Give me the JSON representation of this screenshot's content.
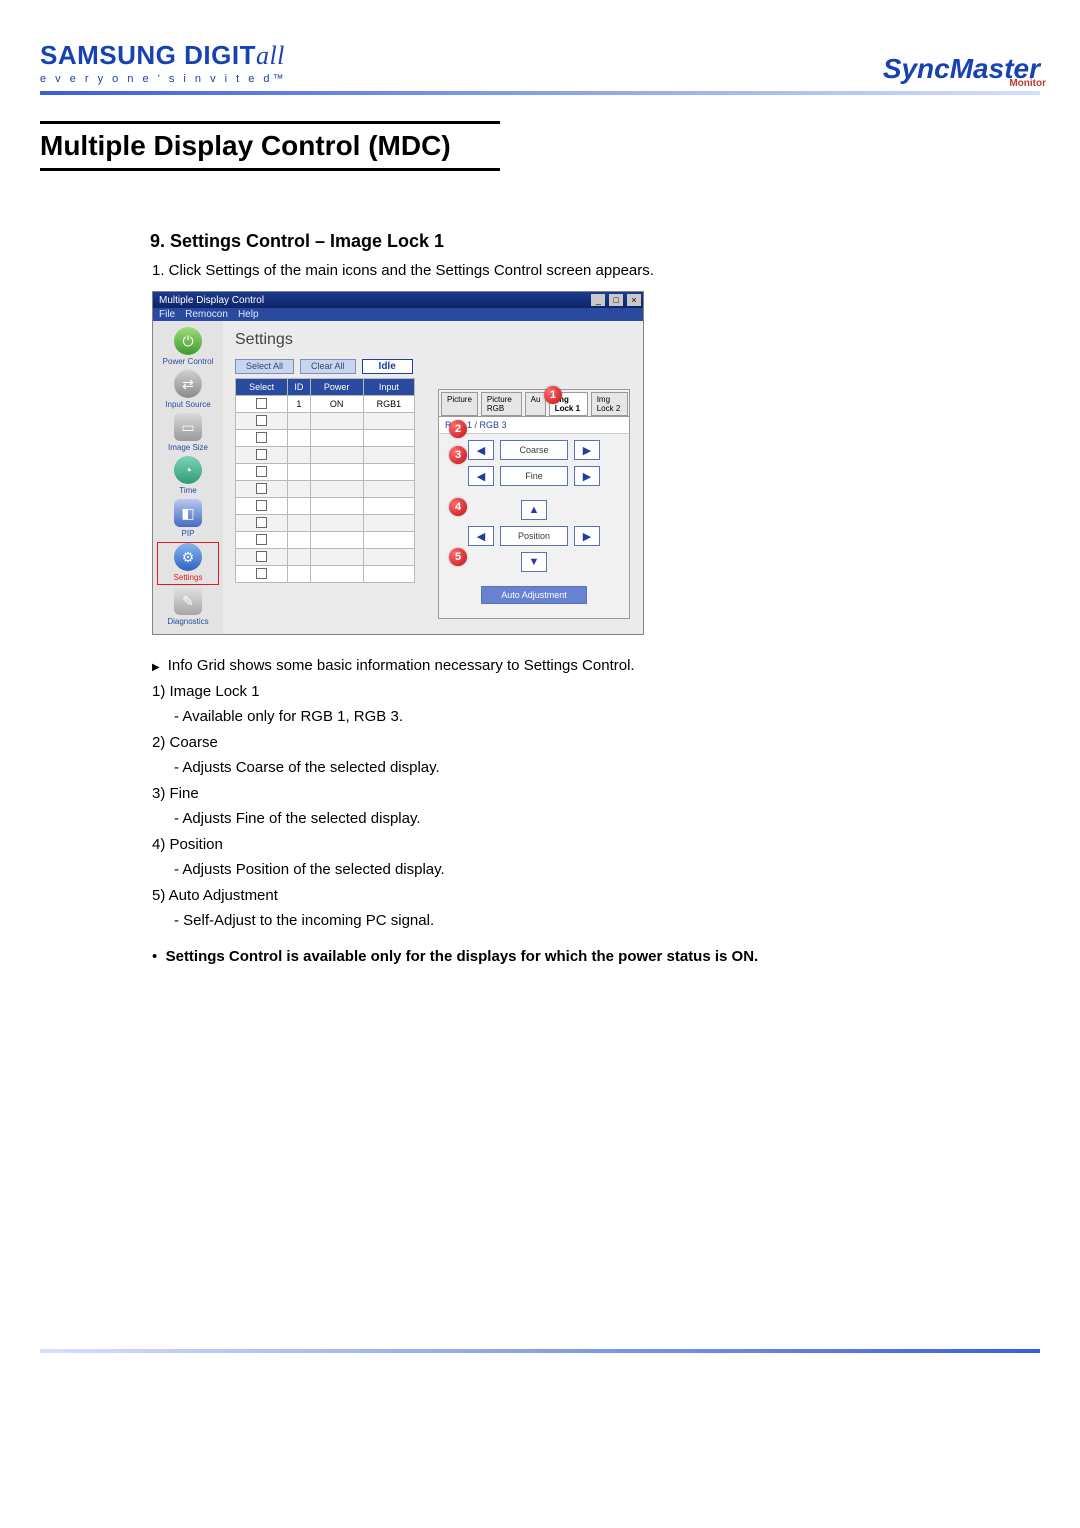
{
  "header": {
    "brand_main": "SAMSUNG DIGIT",
    "brand_italic": "all",
    "tagline": "e v e r y o n e ' s   i n v i t e d™",
    "right_brand": "SyncMaster",
    "right_sub": "Monitor"
  },
  "title": "Multiple Display Control (MDC)",
  "section": {
    "heading": "9. Settings Control – Image Lock 1",
    "step1": "1.  Click Settings of the main icons and the Settings Control screen appears."
  },
  "app": {
    "window_title": "Multiple Display Control",
    "menus": [
      "File",
      "Remocon",
      "Help"
    ],
    "sidebar": [
      {
        "label": "Power Control"
      },
      {
        "label": "Input Source"
      },
      {
        "label": "Image Size"
      },
      {
        "label": "Time"
      },
      {
        "label": "PIP"
      },
      {
        "label": "Settings"
      },
      {
        "label": "Diagnostics"
      }
    ],
    "settings_title": "Settings",
    "buttons": {
      "select_all": "Select All",
      "clear_all": "Clear All",
      "idle": "Idle"
    },
    "grid": {
      "headers": [
        "Select",
        "ID",
        "Power",
        "Input"
      ],
      "row": {
        "id": "1",
        "power": "ON",
        "input": "RGB1"
      }
    },
    "tabs": {
      "picture": "Picture",
      "picture_rgb": "Picture RGB",
      "audio_prefix": "Au",
      "img_lock1": "Img Lock 1",
      "img_lock2": "Img Lock 2"
    },
    "subtab": "RGB 1 / RGB 3",
    "controls": {
      "coarse": "Coarse",
      "fine": "Fine",
      "position": "Position",
      "auto": "Auto Adjustment"
    },
    "callouts": {
      "c1": "1",
      "c2": "2",
      "c3": "3",
      "c4": "4",
      "c5": "5"
    }
  },
  "notes": {
    "intro": "Info Grid shows some basic information necessary to Settings Control.",
    "n1a": "1) Image Lock 1",
    "n1b": "- Available only for RGB 1, RGB 3.",
    "n2a": "2) Coarse",
    "n2b": "- Adjusts Coarse of the selected display.",
    "n3a": "3) Fine",
    "n3b": "- Adjusts Fine of the selected display.",
    "n4a": "4) Position",
    "n4b": "- Adjusts Position of the selected display.",
    "n5a": "5) Auto Adjustment",
    "n5b": "- Self-Adjust to the incoming PC signal.",
    "footnote": "Settings Control is available only for the displays for which the power status is ON."
  }
}
